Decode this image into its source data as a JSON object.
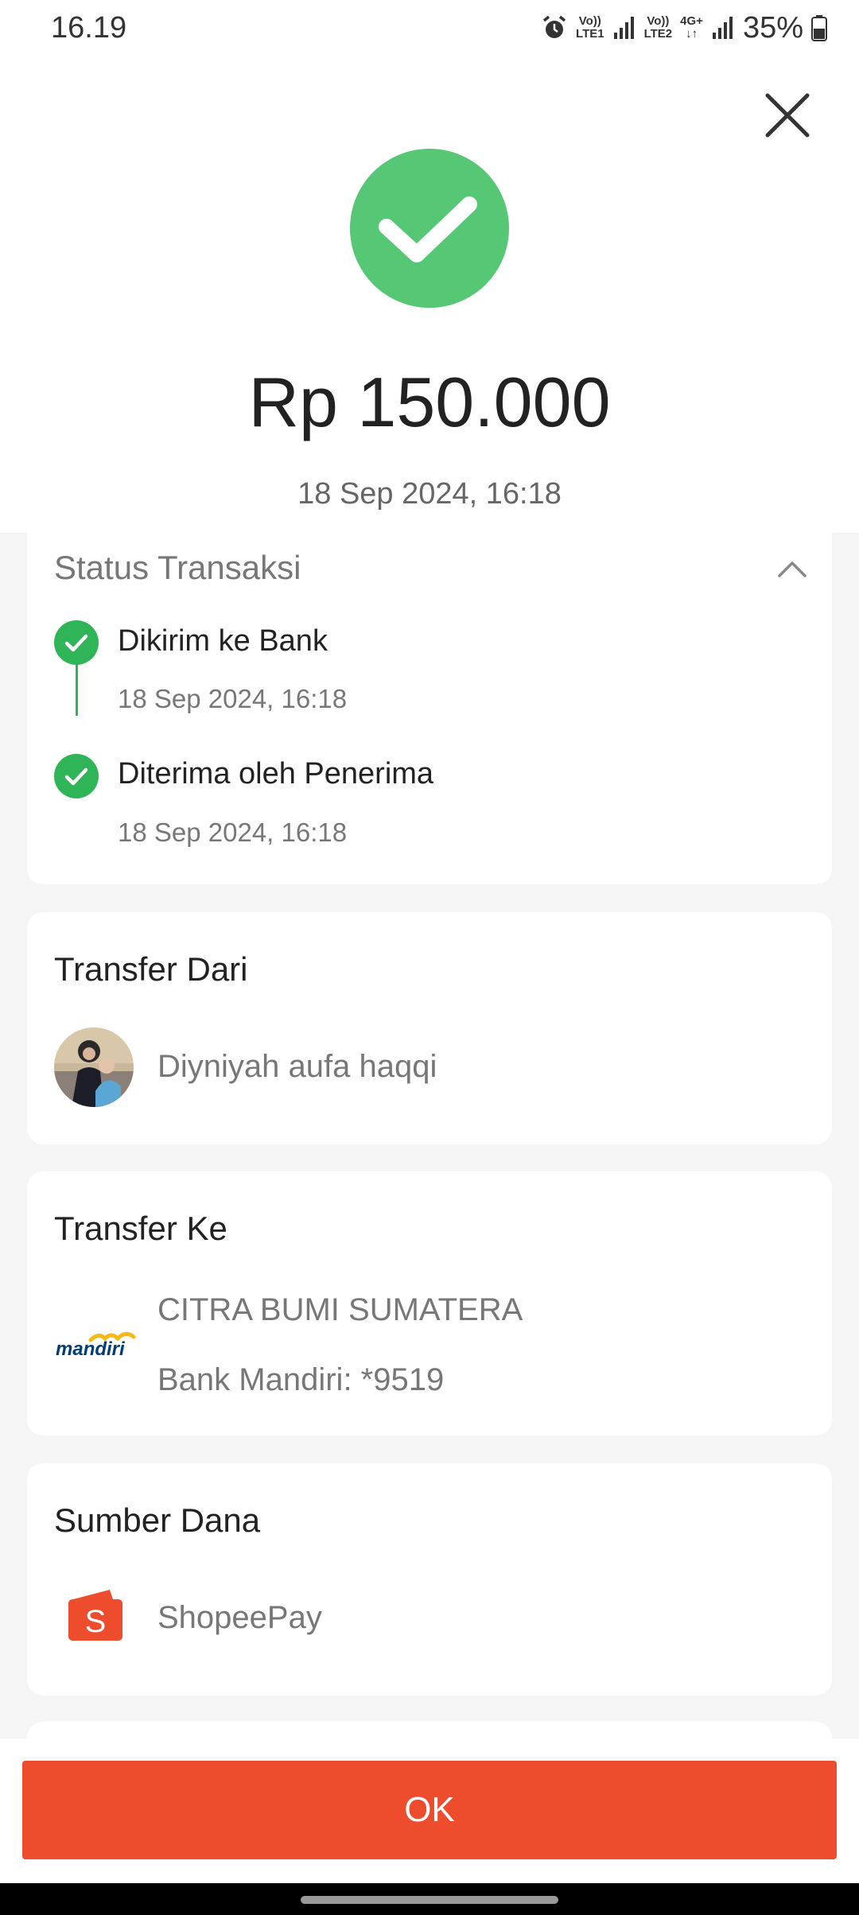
{
  "status_bar": {
    "time": "16.19",
    "volte1_top": "Vo))",
    "volte1_bottom": "LTE1",
    "volte2_top": "Vo))",
    "volte2_bottom": "LTE2",
    "network": "4G+",
    "battery": "35%"
  },
  "header": {
    "amount": "Rp 150.000",
    "date": "18 Sep 2024, 16:18"
  },
  "status_card": {
    "title": "Status Transaksi",
    "steps": [
      {
        "label": "Dikirim ke Bank",
        "date": "18 Sep 2024, 16:18"
      },
      {
        "label": "Diterima oleh Penerima",
        "date": "18 Sep 2024, 16:18"
      }
    ]
  },
  "from_card": {
    "title": "Transfer Dari",
    "name": "Diyniyah aufa haqqi"
  },
  "to_card": {
    "title": "Transfer Ke",
    "name": "CITRA BUMI SUMATERA",
    "account": "Bank Mandiri: *9519",
    "bank_logo_text": "mandiri"
  },
  "source_card": {
    "title": "Sumber Dana",
    "name": "ShopeePay"
  },
  "footer": {
    "ok_label": "OK"
  },
  "colors": {
    "success": "#55c775",
    "step": "#2fb457",
    "primary": "#ee4d2d",
    "mandiri_blue": "#003d79",
    "mandiri_yellow": "#f6b916"
  }
}
